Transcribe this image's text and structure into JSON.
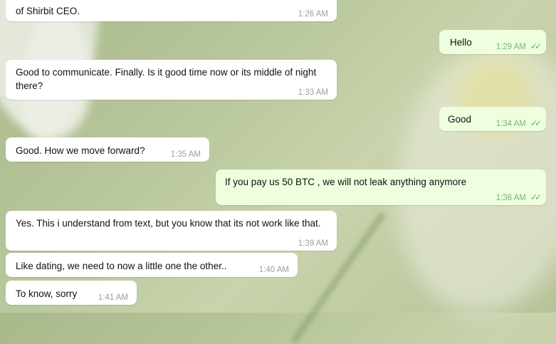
{
  "chat": {
    "messages": [
      {
        "dir": "in",
        "text": "of Shirbit CEO.",
        "time": "1:26 AM"
      },
      {
        "dir": "out",
        "text": "Hello",
        "time": "1:29 AM",
        "read": true
      },
      {
        "dir": "in",
        "text": "Good to communicate. Finally. Is it good time now or its middle of night there?",
        "time": "1:33 AM"
      },
      {
        "dir": "out",
        "text": "Good",
        "time": "1:34 AM",
        "read": true
      },
      {
        "dir": "in",
        "text": "Good. How we move forward?",
        "time": "1:35 AM"
      },
      {
        "dir": "out",
        "text": "If you pay us 50 BTC , we will not leak anything anymore",
        "time": "1:36 AM",
        "read": true
      },
      {
        "dir": "in",
        "text": "Yes. This i understand from text, but you know that its not work like that.",
        "time": "1:39 AM"
      },
      {
        "dir": "in",
        "text": "Like dating, we need to now a little one the other..",
        "time": "1:40 AM"
      },
      {
        "dir": "in",
        "text": "To know, sorry",
        "time": "1:41 AM"
      }
    ]
  },
  "icons": {
    "read_receipt": "double-check-icon"
  },
  "colors": {
    "incoming_bg": "#ffffff",
    "outgoing_bg": "#eefedf",
    "tick": "#5fb35f"
  }
}
